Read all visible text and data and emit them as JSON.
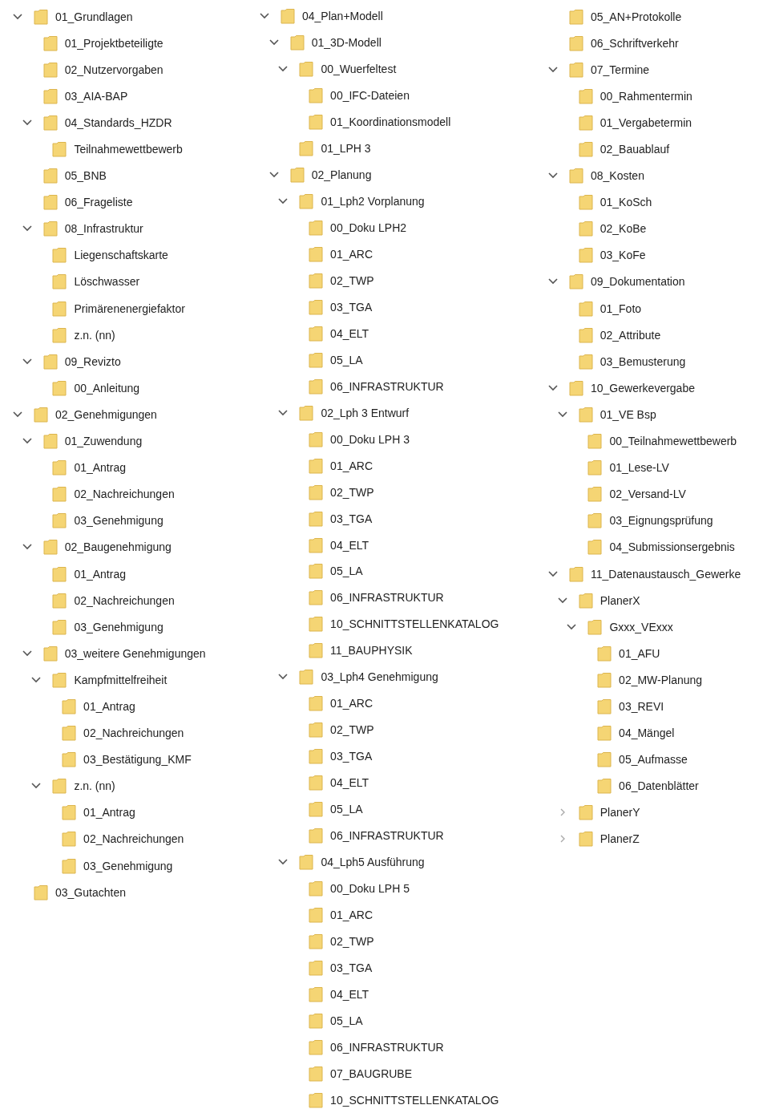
{
  "columns": [
    {
      "nodes": [
        {
          "label": "01_Grundlagen",
          "expanded": true,
          "children": [
            {
              "label": "01_Projektbeteiligte"
            },
            {
              "label": "02_Nutzervorgaben"
            },
            {
              "label": "03_AIA-BAP"
            },
            {
              "label": "04_Standards_HZDR",
              "expanded": true,
              "children": [
                {
                  "label": "Teilnahmewettbewerb"
                }
              ]
            },
            {
              "label": "05_BNB"
            },
            {
              "label": "06_Frageliste"
            },
            {
              "label": "08_Infrastruktur",
              "expanded": true,
              "children": [
                {
                  "label": "Liegenschaftskarte"
                },
                {
                  "label": "Löschwasser"
                },
                {
                  "label": "Primärenenergiefaktor"
                },
                {
                  "label": "z.n. (nn)"
                }
              ]
            },
            {
              "label": "09_Revizto",
              "expanded": true,
              "children": [
                {
                  "label": "00_Anleitung"
                }
              ]
            }
          ]
        },
        {
          "label": "02_Genehmigungen",
          "expanded": true,
          "children": [
            {
              "label": "01_Zuwendung",
              "expanded": true,
              "children": [
                {
                  "label": "01_Antrag"
                },
                {
                  "label": "02_Nachreichungen"
                },
                {
                  "label": "03_Genehmigung"
                }
              ]
            },
            {
              "label": "02_Baugenehmigung",
              "expanded": true,
              "children": [
                {
                  "label": "01_Antrag"
                },
                {
                  "label": "02_Nachreichungen"
                },
                {
                  "label": "03_Genehmigung"
                }
              ]
            },
            {
              "label": "03_weitere Genehmigungen",
              "expanded": true,
              "children": [
                {
                  "label": "Kampfmittelfreiheit",
                  "expanded": true,
                  "children": [
                    {
                      "label": "01_Antrag"
                    },
                    {
                      "label": "02_Nachreichungen"
                    },
                    {
                      "label": "03_Bestätigung_KMF"
                    }
                  ]
                },
                {
                  "label": "z.n. (nn)",
                  "expanded": true,
                  "children": [
                    {
                      "label": "01_Antrag"
                    },
                    {
                      "label": "02_Nachreichungen"
                    },
                    {
                      "label": "03_Genehmigung"
                    }
                  ]
                }
              ]
            }
          ]
        },
        {
          "label": "03_Gutachten"
        }
      ]
    },
    {
      "nodes": [
        {
          "label": "04_Plan+Modell",
          "expanded": true,
          "children": [
            {
              "label": "01_3D-Modell",
              "expanded": true,
              "children": [
                {
                  "label": "00_Wuerfeltest",
                  "expanded": true,
                  "children": [
                    {
                      "label": "00_IFC-Dateien"
                    },
                    {
                      "label": "01_Koordinationsmodell"
                    }
                  ]
                },
                {
                  "label": "01_LPH 3"
                }
              ]
            },
            {
              "label": "02_Planung",
              "expanded": true,
              "children": [
                {
                  "label": "01_Lph2 Vorplanung",
                  "expanded": true,
                  "children": [
                    {
                      "label": "00_Doku LPH2"
                    },
                    {
                      "label": "01_ARC"
                    },
                    {
                      "label": "02_TWP"
                    },
                    {
                      "label": "03_TGA"
                    },
                    {
                      "label": "04_ELT"
                    },
                    {
                      "label": "05_LA"
                    },
                    {
                      "label": "06_INFRASTRUKTUR"
                    }
                  ]
                },
                {
                  "label": "02_Lph 3 Entwurf",
                  "expanded": true,
                  "children": [
                    {
                      "label": "00_Doku LPH 3"
                    },
                    {
                      "label": "01_ARC"
                    },
                    {
                      "label": "02_TWP"
                    },
                    {
                      "label": "03_TGA"
                    },
                    {
                      "label": "04_ELT"
                    },
                    {
                      "label": "05_LA"
                    },
                    {
                      "label": "06_INFRASTRUKTUR"
                    },
                    {
                      "label": "10_SCHNITTSTELLENKATALOG"
                    },
                    {
                      "label": "11_BAUPHYSIK"
                    }
                  ]
                },
                {
                  "label": "03_Lph4 Genehmigung",
                  "expanded": true,
                  "children": [
                    {
                      "label": "01_ARC"
                    },
                    {
                      "label": "02_TWP"
                    },
                    {
                      "label": "03_TGA"
                    },
                    {
                      "label": "04_ELT"
                    },
                    {
                      "label": "05_LA"
                    },
                    {
                      "label": "06_INFRASTRUKTUR"
                    }
                  ]
                },
                {
                  "label": "04_Lph5 Ausführung",
                  "expanded": true,
                  "children": [
                    {
                      "label": "00_Doku LPH 5"
                    },
                    {
                      "label": "01_ARC"
                    },
                    {
                      "label": "02_TWP"
                    },
                    {
                      "label": "03_TGA"
                    },
                    {
                      "label": "04_ELT"
                    },
                    {
                      "label": "05_LA"
                    },
                    {
                      "label": "06_INFRASTRUKTUR"
                    },
                    {
                      "label": "07_BAUGRUBE"
                    },
                    {
                      "label": "10_SCHNITTSTELLENKATALOG"
                    }
                  ]
                }
              ]
            }
          ]
        }
      ]
    },
    {
      "nodes": [
        {
          "label": "05_AN+Protokolle"
        },
        {
          "label": "06_Schriftverkehr"
        },
        {
          "label": "07_Termine",
          "expanded": true,
          "children": [
            {
              "label": "00_Rahmentermin"
            },
            {
              "label": "01_Vergabetermin"
            },
            {
              "label": "02_Bauablauf"
            }
          ]
        },
        {
          "label": "08_Kosten",
          "expanded": true,
          "children": [
            {
              "label": "01_KoSch"
            },
            {
              "label": "02_KoBe"
            },
            {
              "label": "03_KoFe"
            }
          ]
        },
        {
          "label": "09_Dokumentation",
          "expanded": true,
          "children": [
            {
              "label": "01_Foto"
            },
            {
              "label": "02_Attribute"
            },
            {
              "label": "03_Bemusterung"
            }
          ]
        },
        {
          "label": "10_Gewerkevergabe",
          "expanded": true,
          "children": [
            {
              "label": "01_VE Bsp",
              "expanded": true,
              "children": [
                {
                  "label": "00_Teilnahmewettbewerb"
                },
                {
                  "label": "01_Lese-LV"
                },
                {
                  "label": "02_Versand-LV"
                },
                {
                  "label": "03_Eignungsprüfung"
                },
                {
                  "label": "04_Submissionsergebnis"
                }
              ]
            }
          ]
        },
        {
          "label": "11_Datenaustausch_Gewerke",
          "expanded": true,
          "children": [
            {
              "label": "PlanerX",
              "expanded": true,
              "children": [
                {
                  "label": "Gxxx_VExxx",
                  "expanded": true,
                  "children": [
                    {
                      "label": "01_AFU"
                    },
                    {
                      "label": "02_MW-Planung"
                    },
                    {
                      "label": "03_REVI"
                    },
                    {
                      "label": "04_Mängel"
                    },
                    {
                      "label": "05_Aufmasse"
                    },
                    {
                      "label": "06_Datenblätter"
                    }
                  ]
                }
              ]
            },
            {
              "label": "PlanerY",
              "expanded": false
            },
            {
              "label": "PlanerZ",
              "expanded": false
            }
          ]
        }
      ]
    }
  ]
}
